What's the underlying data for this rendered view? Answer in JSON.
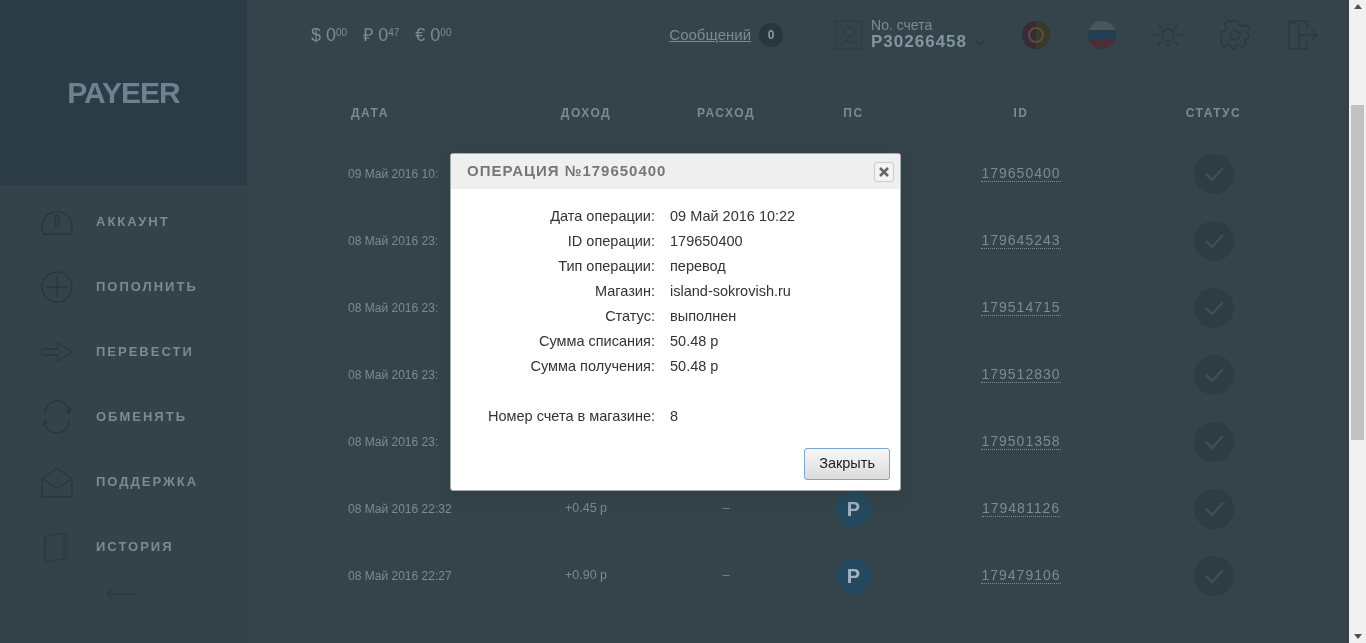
{
  "logo": "PAYEER",
  "sidebar": {
    "items": [
      {
        "label": "АККАУНТ"
      },
      {
        "label": "ПОПОЛНИТЬ"
      },
      {
        "label": "ПЕРЕВЕСТИ"
      },
      {
        "label": "ОБМЕНЯТЬ"
      },
      {
        "label": "ПОДДЕРЖКА"
      },
      {
        "label": "ИСТОРИЯ"
      }
    ]
  },
  "header": {
    "balances": [
      {
        "symbol": "$",
        "amount": "0",
        "cents": "00"
      },
      {
        "symbol": "₽",
        "amount": "0",
        "cents": "47"
      },
      {
        "symbol": "€",
        "amount": "0",
        "cents": "00"
      }
    ],
    "messages": {
      "label": "Сообщений",
      "count": "0"
    },
    "account": {
      "label": "No. счета",
      "number": "P30266458"
    }
  },
  "table": {
    "columns": [
      "ДАТА",
      "ДОХОД",
      "РАСХОД",
      "ПС",
      "ID",
      "СТАТУС"
    ],
    "rows": [
      {
        "date": "09 Май 2016 10:",
        "id": "179650400",
        "done": true
      },
      {
        "date": "08 Май 2016 23:",
        "id": "179645243",
        "done": true
      },
      {
        "date": "08 Май 2016 23:",
        "id": "179514715",
        "done": true
      },
      {
        "date": "08 Май 2016 23:",
        "id": "179512830",
        "done": true
      },
      {
        "date": "08 Май 2016 23:",
        "id": "179501358",
        "done": true
      },
      {
        "date": "08 Май 2016 22:32",
        "income": "+0.45 р",
        "expense": "–",
        "ps": "P",
        "id": "179481126",
        "done": true
      },
      {
        "date": "08 Май 2016 22:27",
        "income": "+0.90 р",
        "expense": "–",
        "ps": "P",
        "id": "179479106",
        "done": true
      }
    ]
  },
  "dialog": {
    "title": "ОПЕРАЦИЯ №179650400",
    "details": [
      {
        "label": "Дата операции:",
        "value": "09 Май 2016 10:22"
      },
      {
        "label": "ID операции:",
        "value": "179650400"
      },
      {
        "label": "Тип операции:",
        "value": "перевод"
      },
      {
        "label": "Магазин:",
        "value": "island-sokrovish.ru"
      },
      {
        "label": "Статус:",
        "value": "выполнен"
      },
      {
        "label": "Сумма списания:",
        "value": "50.48 р"
      },
      {
        "label": "Сумма получения:",
        "value": "50.48 р"
      }
    ],
    "shop_fields": [
      {
        "label": "Номер счета в магазине:",
        "value": "8"
      }
    ],
    "button": "Закрыть"
  }
}
